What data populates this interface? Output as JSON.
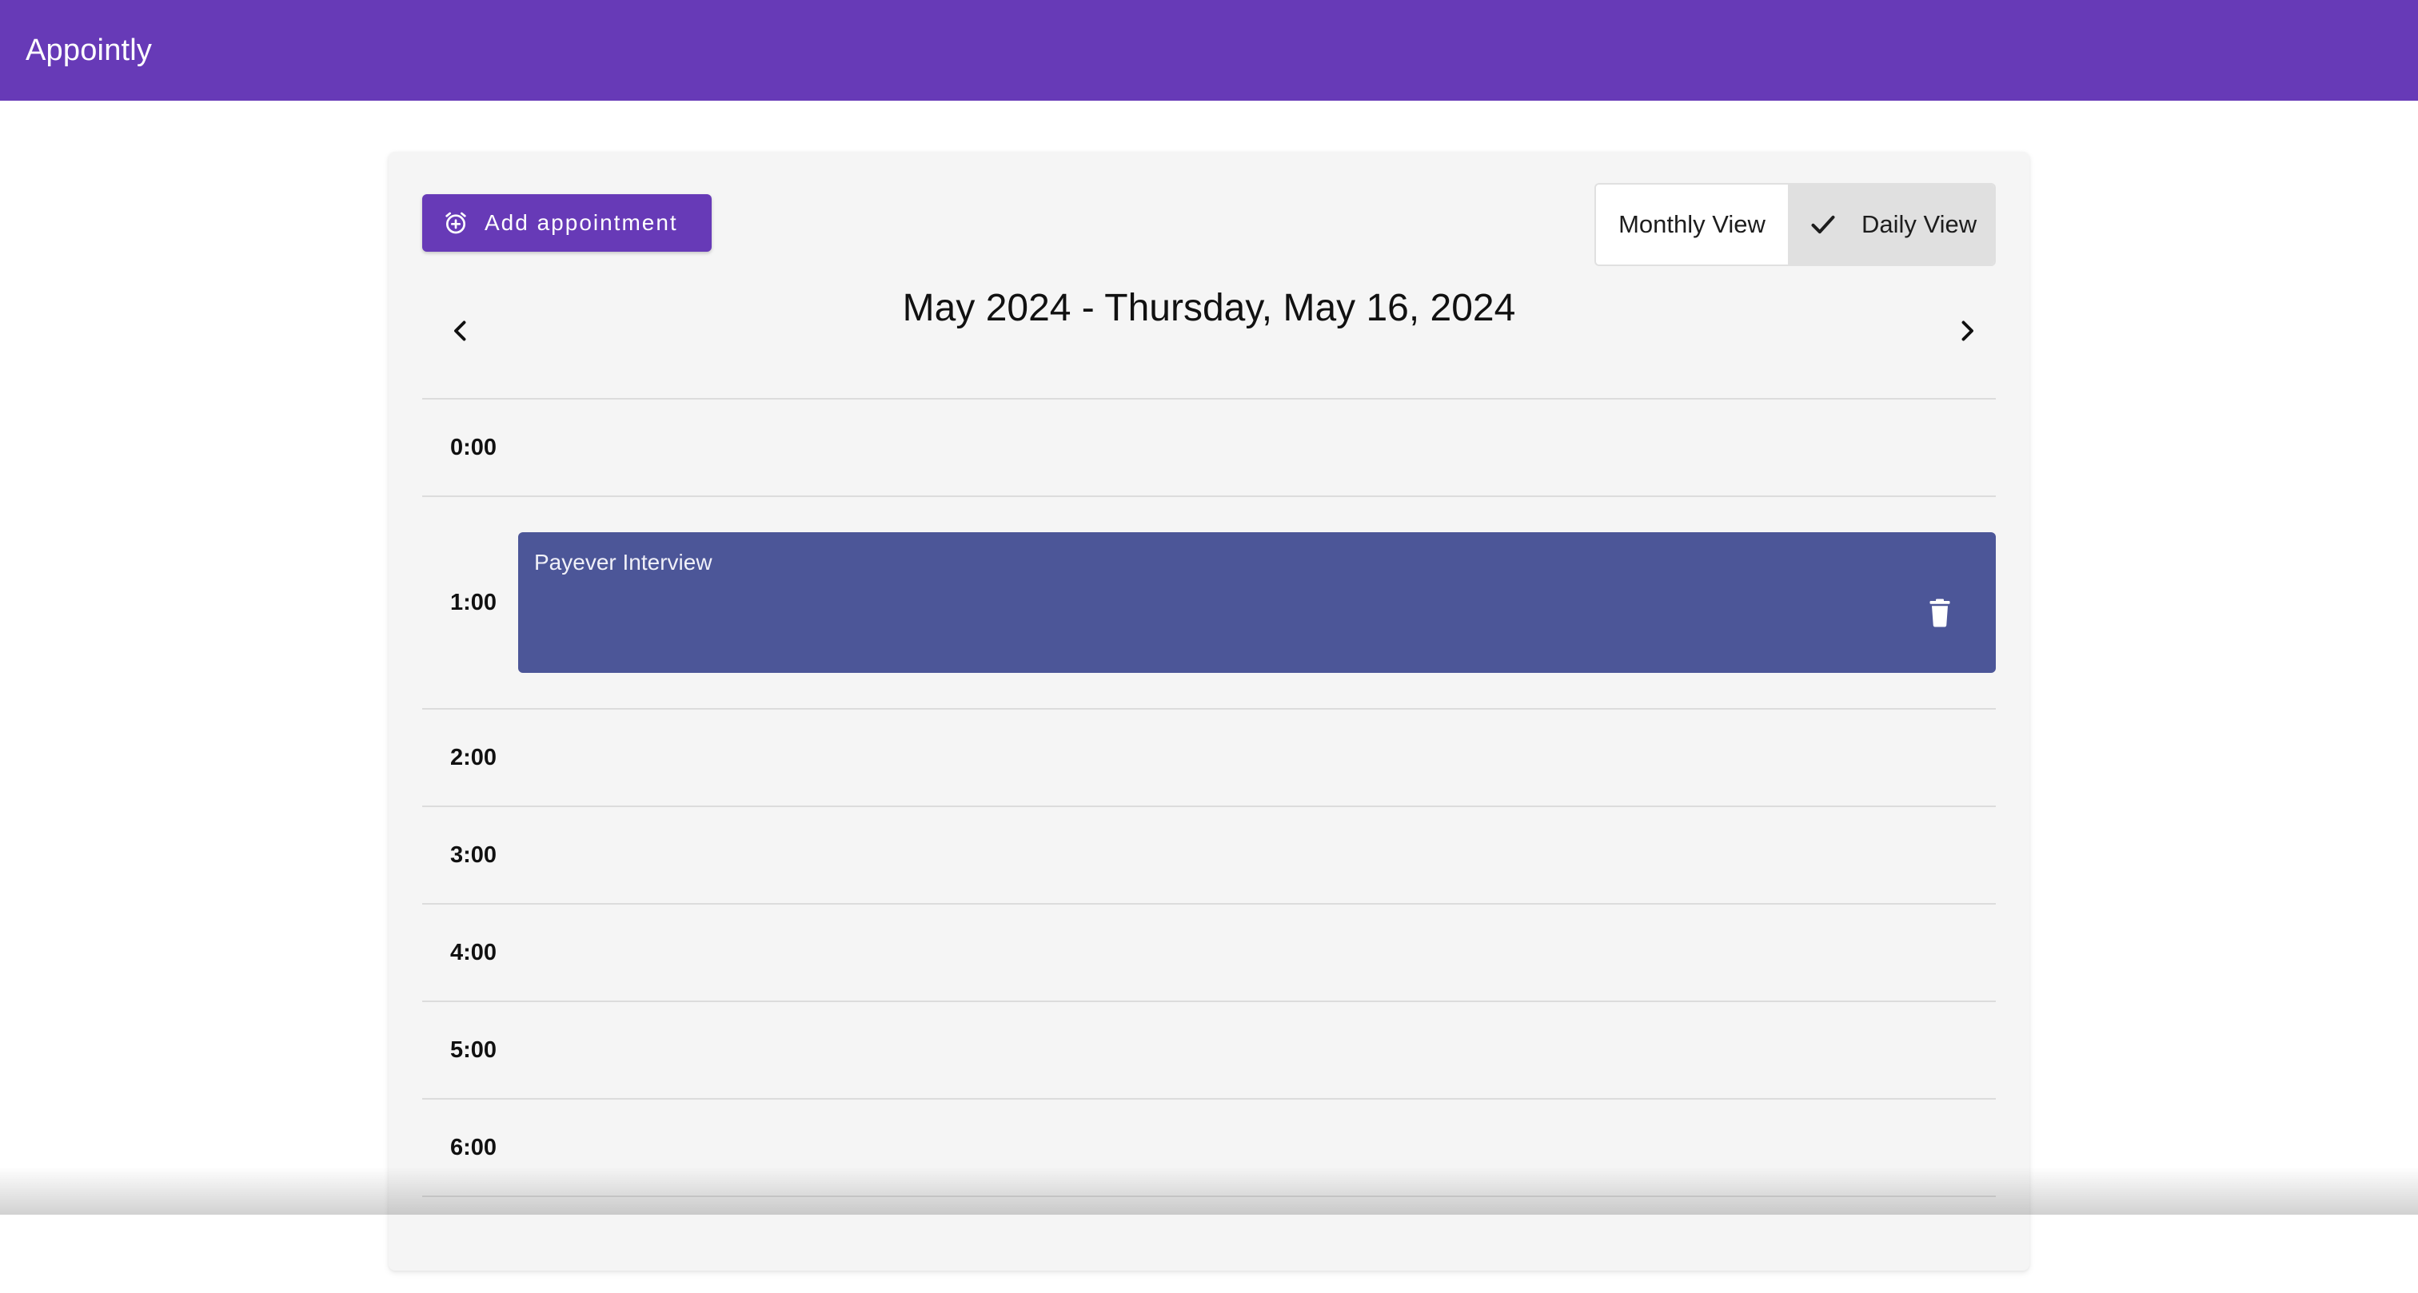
{
  "app": {
    "title": "Appointly",
    "brand_color": "#673ab7"
  },
  "toolbar": {
    "add_label": "Add appointment",
    "add_icon": "alarm-add-icon"
  },
  "view_toggle": {
    "monthly_label": "Monthly View",
    "daily_label": "Daily View",
    "selected": "Daily View"
  },
  "navigation": {
    "heading": "May 2024 - Thursday, May 16, 2024",
    "prev_icon": "chevron-left-icon",
    "next_icon": "chevron-right-icon"
  },
  "schedule": {
    "hours": [
      "0:00",
      "1:00",
      "2:00",
      "3:00",
      "4:00",
      "5:00",
      "6:00"
    ],
    "appointments": [
      {
        "hour": "1:00",
        "title": "Payever Interview",
        "color": "#4c5698",
        "delete_icon": "trash-icon"
      }
    ]
  }
}
